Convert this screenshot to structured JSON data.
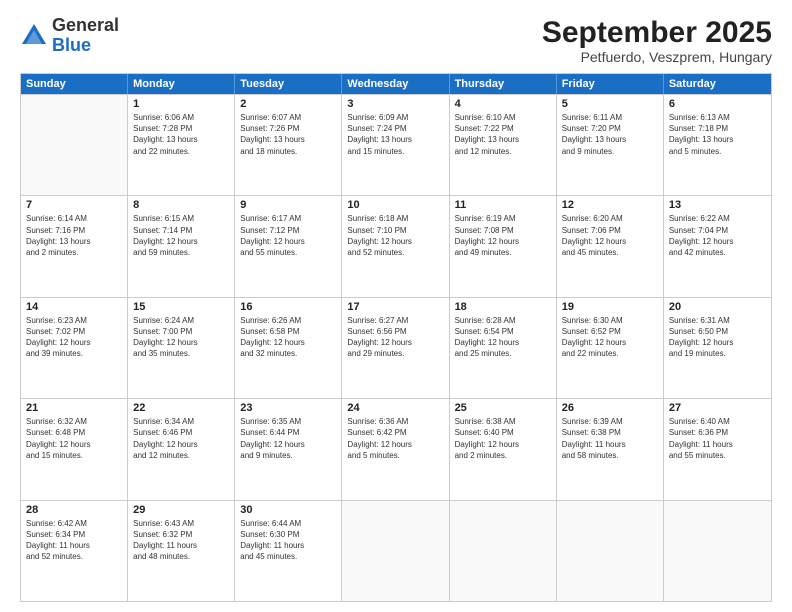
{
  "logo": {
    "general": "General",
    "blue": "Blue"
  },
  "title": "September 2025",
  "subtitle": "Petfuerdo, Veszprem, Hungary",
  "days": [
    "Sunday",
    "Monday",
    "Tuesday",
    "Wednesday",
    "Thursday",
    "Friday",
    "Saturday"
  ],
  "rows": [
    [
      {
        "date": "",
        "info": ""
      },
      {
        "date": "1",
        "info": "Sunrise: 6:06 AM\nSunset: 7:28 PM\nDaylight: 13 hours\nand 22 minutes."
      },
      {
        "date": "2",
        "info": "Sunrise: 6:07 AM\nSunset: 7:26 PM\nDaylight: 13 hours\nand 18 minutes."
      },
      {
        "date": "3",
        "info": "Sunrise: 6:09 AM\nSunset: 7:24 PM\nDaylight: 13 hours\nand 15 minutes."
      },
      {
        "date": "4",
        "info": "Sunrise: 6:10 AM\nSunset: 7:22 PM\nDaylight: 13 hours\nand 12 minutes."
      },
      {
        "date": "5",
        "info": "Sunrise: 6:11 AM\nSunset: 7:20 PM\nDaylight: 13 hours\nand 9 minutes."
      },
      {
        "date": "6",
        "info": "Sunrise: 6:13 AM\nSunset: 7:18 PM\nDaylight: 13 hours\nand 5 minutes."
      }
    ],
    [
      {
        "date": "7",
        "info": "Sunrise: 6:14 AM\nSunset: 7:16 PM\nDaylight: 13 hours\nand 2 minutes."
      },
      {
        "date": "8",
        "info": "Sunrise: 6:15 AM\nSunset: 7:14 PM\nDaylight: 12 hours\nand 59 minutes."
      },
      {
        "date": "9",
        "info": "Sunrise: 6:17 AM\nSunset: 7:12 PM\nDaylight: 12 hours\nand 55 minutes."
      },
      {
        "date": "10",
        "info": "Sunrise: 6:18 AM\nSunset: 7:10 PM\nDaylight: 12 hours\nand 52 minutes."
      },
      {
        "date": "11",
        "info": "Sunrise: 6:19 AM\nSunset: 7:08 PM\nDaylight: 12 hours\nand 49 minutes."
      },
      {
        "date": "12",
        "info": "Sunrise: 6:20 AM\nSunset: 7:06 PM\nDaylight: 12 hours\nand 45 minutes."
      },
      {
        "date": "13",
        "info": "Sunrise: 6:22 AM\nSunset: 7:04 PM\nDaylight: 12 hours\nand 42 minutes."
      }
    ],
    [
      {
        "date": "14",
        "info": "Sunrise: 6:23 AM\nSunset: 7:02 PM\nDaylight: 12 hours\nand 39 minutes."
      },
      {
        "date": "15",
        "info": "Sunrise: 6:24 AM\nSunset: 7:00 PM\nDaylight: 12 hours\nand 35 minutes."
      },
      {
        "date": "16",
        "info": "Sunrise: 6:26 AM\nSunset: 6:58 PM\nDaylight: 12 hours\nand 32 minutes."
      },
      {
        "date": "17",
        "info": "Sunrise: 6:27 AM\nSunset: 6:56 PM\nDaylight: 12 hours\nand 29 minutes."
      },
      {
        "date": "18",
        "info": "Sunrise: 6:28 AM\nSunset: 6:54 PM\nDaylight: 12 hours\nand 25 minutes."
      },
      {
        "date": "19",
        "info": "Sunrise: 6:30 AM\nSunset: 6:52 PM\nDaylight: 12 hours\nand 22 minutes."
      },
      {
        "date": "20",
        "info": "Sunrise: 6:31 AM\nSunset: 6:50 PM\nDaylight: 12 hours\nand 19 minutes."
      }
    ],
    [
      {
        "date": "21",
        "info": "Sunrise: 6:32 AM\nSunset: 6:48 PM\nDaylight: 12 hours\nand 15 minutes."
      },
      {
        "date": "22",
        "info": "Sunrise: 6:34 AM\nSunset: 6:46 PM\nDaylight: 12 hours\nand 12 minutes."
      },
      {
        "date": "23",
        "info": "Sunrise: 6:35 AM\nSunset: 6:44 PM\nDaylight: 12 hours\nand 9 minutes."
      },
      {
        "date": "24",
        "info": "Sunrise: 6:36 AM\nSunset: 6:42 PM\nDaylight: 12 hours\nand 5 minutes."
      },
      {
        "date": "25",
        "info": "Sunrise: 6:38 AM\nSunset: 6:40 PM\nDaylight: 12 hours\nand 2 minutes."
      },
      {
        "date": "26",
        "info": "Sunrise: 6:39 AM\nSunset: 6:38 PM\nDaylight: 11 hours\nand 58 minutes."
      },
      {
        "date": "27",
        "info": "Sunrise: 6:40 AM\nSunset: 6:36 PM\nDaylight: 11 hours\nand 55 minutes."
      }
    ],
    [
      {
        "date": "28",
        "info": "Sunrise: 6:42 AM\nSunset: 6:34 PM\nDaylight: 11 hours\nand 52 minutes."
      },
      {
        "date": "29",
        "info": "Sunrise: 6:43 AM\nSunset: 6:32 PM\nDaylight: 11 hours\nand 48 minutes."
      },
      {
        "date": "30",
        "info": "Sunrise: 6:44 AM\nSunset: 6:30 PM\nDaylight: 11 hours\nand 45 minutes."
      },
      {
        "date": "",
        "info": ""
      },
      {
        "date": "",
        "info": ""
      },
      {
        "date": "",
        "info": ""
      },
      {
        "date": "",
        "info": ""
      }
    ]
  ]
}
